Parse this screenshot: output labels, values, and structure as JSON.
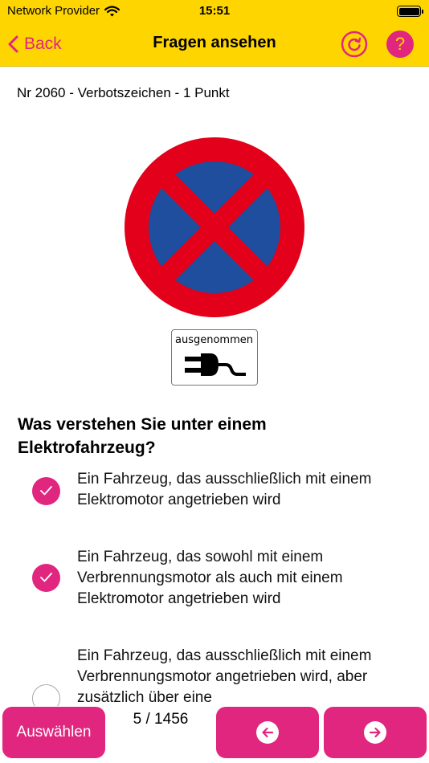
{
  "status_bar": {
    "carrier": "Network Provider",
    "time": "15:51"
  },
  "nav": {
    "back_label": "Back",
    "title": "Fragen ansehen",
    "help_label": "?"
  },
  "question": {
    "meta": "Nr 2060 - Verbotszeichen - 1 Punkt",
    "supplementary_plate_text": "ausgenommen",
    "text": "Was verstehen Sie unter einem Elektrofahrzeug?",
    "answers": [
      {
        "text": "Ein Fahrzeug, das ausschließlich mit einem Elektromotor angetrieben wird",
        "checked": true
      },
      {
        "text": "Ein Fahrzeug, das sowohl mit einem Verbrennungsmotor als auch mit einem Elektromotor angetrieben wird",
        "checked": true
      },
      {
        "text": "Ein Fahrzeug, das ausschließlich mit einem Verbrennungsmotor angetrieben wird, aber zusätzlich über eine",
        "checked": false
      }
    ]
  },
  "bottom": {
    "select_label": "Auswählen",
    "page_counter": "5 / 1456"
  },
  "colors": {
    "bar_yellow": "#ffd500",
    "accent_pink": "#e0267f",
    "sign_red": "#e2001a",
    "sign_blue": "#1f4e9e"
  },
  "icons": {
    "wifi": "wifi-icon",
    "battery": "battery-icon",
    "back": "chevron-left-icon",
    "refresh": "refresh-icon",
    "help": "question-icon",
    "check": "checkmark-icon",
    "prev": "arrow-left-icon",
    "next": "arrow-right-icon"
  }
}
